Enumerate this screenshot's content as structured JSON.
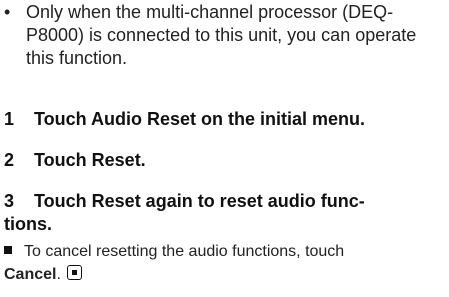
{
  "note": {
    "bullet": "•",
    "text": "Only when the multi-channel processor (DEQ-P8000) is connected to this unit, you can operate this function."
  },
  "steps": [
    {
      "num": "1",
      "text": "Touch Audio Reset on the initial menu."
    },
    {
      "num": "2",
      "text": "Touch Reset."
    },
    {
      "num": "3",
      "text": "Touch Reset again to reset audio func-",
      "cont": "tions."
    }
  ],
  "tip": {
    "text": "To cancel resetting the audio functions, touch",
    "cancel": "Cancel",
    "period": "."
  }
}
